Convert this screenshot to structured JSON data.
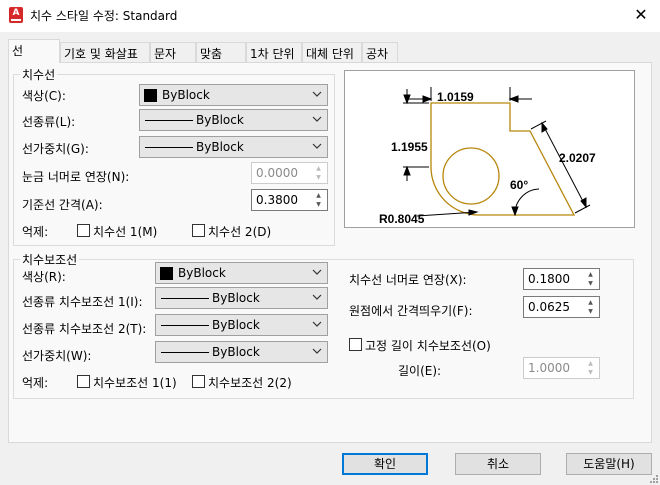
{
  "window": {
    "title": "치수 스타일 수정: Standard",
    "close_glyph": "✕",
    "app_icon_letter": "A"
  },
  "tabs": [
    "선",
    "기호 및 화살표",
    "문자",
    "맞춤",
    "1차 단위",
    "대체 단위",
    "공차"
  ],
  "dim_lines": {
    "legend": "치수선",
    "color_label": "색상(C):",
    "color_value": "ByBlock",
    "linetype_label": "선종류(L):",
    "linetype_value": "ByBlock",
    "lineweight_label": "선가중치(G):",
    "lineweight_value": "ByBlock",
    "extend_label": "눈금 너머로 연장(N):",
    "extend_value": "0.0000",
    "baseline_label": "기준선 간격(A):",
    "baseline_value": "0.3800",
    "suppress_label": "억제:",
    "suppress1": "치수선 1(M)",
    "suppress2": "치수선 2(D)"
  },
  "ext_lines": {
    "legend": "치수보조선",
    "color_label": "색상(R):",
    "color_value": "ByBlock",
    "lt1_label": "선종류 치수보조선 1(I):",
    "lt1_value": "ByBlock",
    "lt2_label": "선종류 치수보조선 2(T):",
    "lt2_value": "ByBlock",
    "lineweight_label": "선가중치(W):",
    "lineweight_value": "ByBlock",
    "suppress_label": "억제:",
    "suppress1": "치수보조선 1(1)",
    "suppress2": "치수보조선 2(2)",
    "extend_label": "치수선 너머로 연장(X):",
    "extend_value": "0.1800",
    "offset_label": "원점에서 간격띄우기(F):",
    "offset_value": "0.0625",
    "fixed_label": "고정 길이 치수보조선(O)",
    "length_label": "길이(E):",
    "length_value": "1.0000"
  },
  "preview": {
    "dim_top": "1.0159",
    "dim_left": "1.1955",
    "dim_diag": "2.0207",
    "angle": "60°",
    "radius": "R0.8045",
    "dim_color": "#000000",
    "shape_color": "#b8860b"
  },
  "buttons": {
    "ok": "확인",
    "cancel": "취소",
    "help": "도움말(H)"
  }
}
